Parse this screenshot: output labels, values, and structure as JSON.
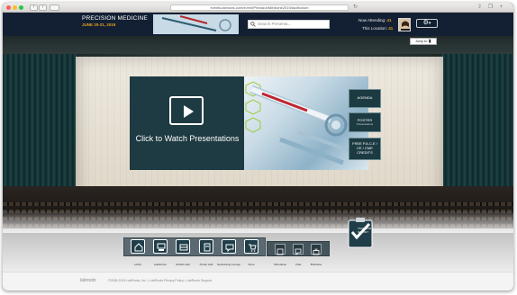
{
  "browser": {
    "url": "events.labroots.com/event/PrecisionMedicine2019/auditorium"
  },
  "event": {
    "title": "PRECISION MEDICINE",
    "dates": "JUNE 20-21, 2019"
  },
  "search": {
    "placeholder": "Search Presenta..."
  },
  "status": {
    "attending_label": "Now Attending:",
    "attending_count": "41",
    "location_label": "This Location:",
    "location_count": "41"
  },
  "jump_label": "Jump to:",
  "video": {
    "cta": "Click to Watch Presentations"
  },
  "side_buttons": [
    {
      "label": "AGENDA",
      "sub": ""
    },
    {
      "label": "POSTER",
      "sub": "Presentations"
    },
    {
      "label": "FREE P.A.C.E / CE / CME CREDITS",
      "sub": ""
    }
  ],
  "nav": {
    "main": [
      {
        "label": "Lobby",
        "icon": "lobby-icon"
      },
      {
        "label": "Auditorium",
        "icon": "auditorium-icon"
      },
      {
        "label": "Exhibit Hall",
        "icon": "exhibit-hall-icon"
      },
      {
        "label": "Poster Hall",
        "icon": "poster-hall-icon"
      },
      {
        "label": "Networking Lounge",
        "icon": "networking-lounge-icon"
      },
      {
        "label": "Store",
        "icon": "store-icon"
      }
    ],
    "secondary": [
      {
        "label": "Schedules",
        "icon": "schedules-icon"
      },
      {
        "label": "Chat",
        "icon": "chat-icon"
      },
      {
        "label": "Briefcase",
        "icon": "briefcase-icon"
      }
    ],
    "survey_label": "TAKE OUR SURVEY"
  },
  "footer": {
    "logo": "labroots",
    "text": "©2008-2019 LabRoots, Inc.  •  LabRoots Privacy Policy  •  LabRoots Support"
  },
  "colors": {
    "topbar": "#132033",
    "accent": "#e9a01b",
    "panel": "#1e3a42"
  }
}
